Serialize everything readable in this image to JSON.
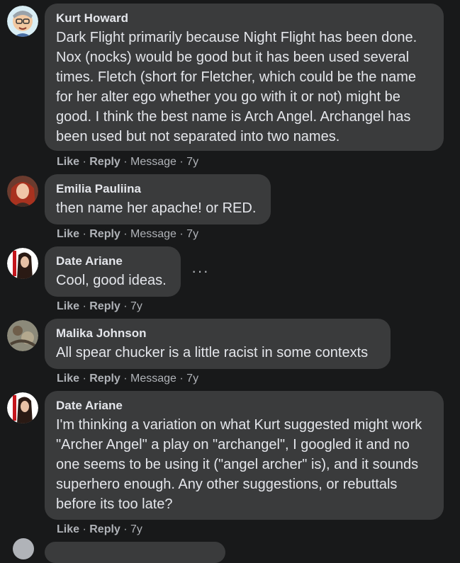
{
  "comments": [
    {
      "author": "Kurt Howard",
      "text": "Dark Flight primarily because Night Flight has been done. Nox (nocks) would be good but it has been used several times. Fletch (short for Fletcher, which could be the name for her alter ego whether you go with it or not) might be good. I think the best name is Arch Angel. Archangel has been used but not separated into two names.",
      "like": "Like",
      "reply": "Reply",
      "message": "Message",
      "time": "7y"
    },
    {
      "author": "Emilia Pauliina",
      "text": "then name her apache! or RED.",
      "like": "Like",
      "reply": "Reply",
      "message": "Message",
      "time": "7y"
    },
    {
      "author": "Date Ariane",
      "text": "Cool, good ideas.",
      "like": "Like",
      "reply": "Reply",
      "time": "7y",
      "more": "···"
    },
    {
      "author": "Malika Johnson",
      "text": "All spear chucker is a little racist in some contexts",
      "like": "Like",
      "reply": "Reply",
      "message": "Message",
      "time": "7y"
    },
    {
      "author": "Date Ariane",
      "text": "I'm thinking a variation on what Kurt suggested might work \"Archer Angel\" a play on \"archangel\", I googled it and no one seems to be using it (\"angel archer\" is), and it sounds superhero enough. Any other suggestions, or rebuttals before its too late?",
      "like": "Like",
      "reply": "Reply",
      "time": "7y"
    }
  ],
  "separator": " · ",
  "colors": {
    "background": "#18191a",
    "bubble": "#3a3b3c",
    "text": "#e4e6eb",
    "secondary": "#b0b3b8"
  }
}
